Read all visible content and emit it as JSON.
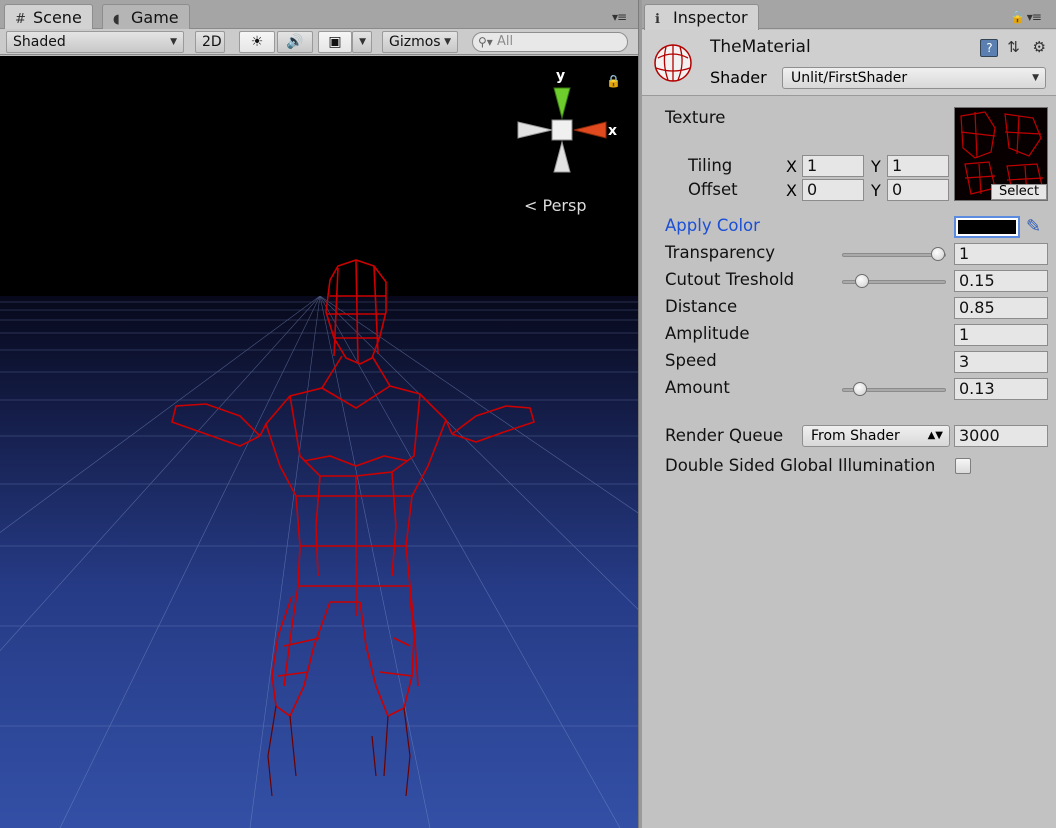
{
  "scene": {
    "tabs": [
      {
        "label": "Scene",
        "icon": "grid-icon"
      },
      {
        "label": "Game",
        "icon": "pacman-icon"
      }
    ],
    "toolbar": {
      "shading_mode": "Shaded",
      "mode_2d": "2D",
      "gizmos": "Gizmos",
      "search_placeholder": "All"
    },
    "gizmo": {
      "axis_y": "y",
      "axis_x": "x",
      "projection": "Persp"
    },
    "background_color": "#000000",
    "floor_color": "#3350a6",
    "wireframe_color": "#cc0000"
  },
  "inspector": {
    "tab": {
      "label": "Inspector",
      "icon": "info-icon"
    },
    "material_name": "TheMaterial",
    "shader_label": "Shader",
    "shader_value": "Unlit/FirstShader",
    "texture": {
      "label": "Texture",
      "tiling_label": "Tiling",
      "offset_label": "Offset",
      "x_label": "X",
      "y_label": "Y",
      "tiling_x": "1",
      "tiling_y": "1",
      "offset_x": "0",
      "offset_y": "0",
      "select_label": "Select"
    },
    "apply_color": {
      "label": "Apply Color",
      "value": "#000000"
    },
    "properties": [
      {
        "label": "Transparency",
        "value": "1",
        "slider": true,
        "fraction": 1.0
      },
      {
        "label": "Cutout Treshold",
        "value": "0.15",
        "slider": true,
        "fraction": 0.15
      },
      {
        "label": "Distance",
        "value": "0.85",
        "slider": false
      },
      {
        "label": "Amplitude",
        "value": "1",
        "slider": false
      },
      {
        "label": "Speed",
        "value": "3",
        "slider": false
      },
      {
        "label": "Amount",
        "value": "0.13",
        "slider": true,
        "fraction": 0.13
      }
    ],
    "render_queue": {
      "label": "Render Queue",
      "mode": "From Shader",
      "value": "3000"
    },
    "double_sided_gi": {
      "label": "Double Sided Global Illumination",
      "checked": false
    },
    "accent_color": "#1a4fd6"
  }
}
